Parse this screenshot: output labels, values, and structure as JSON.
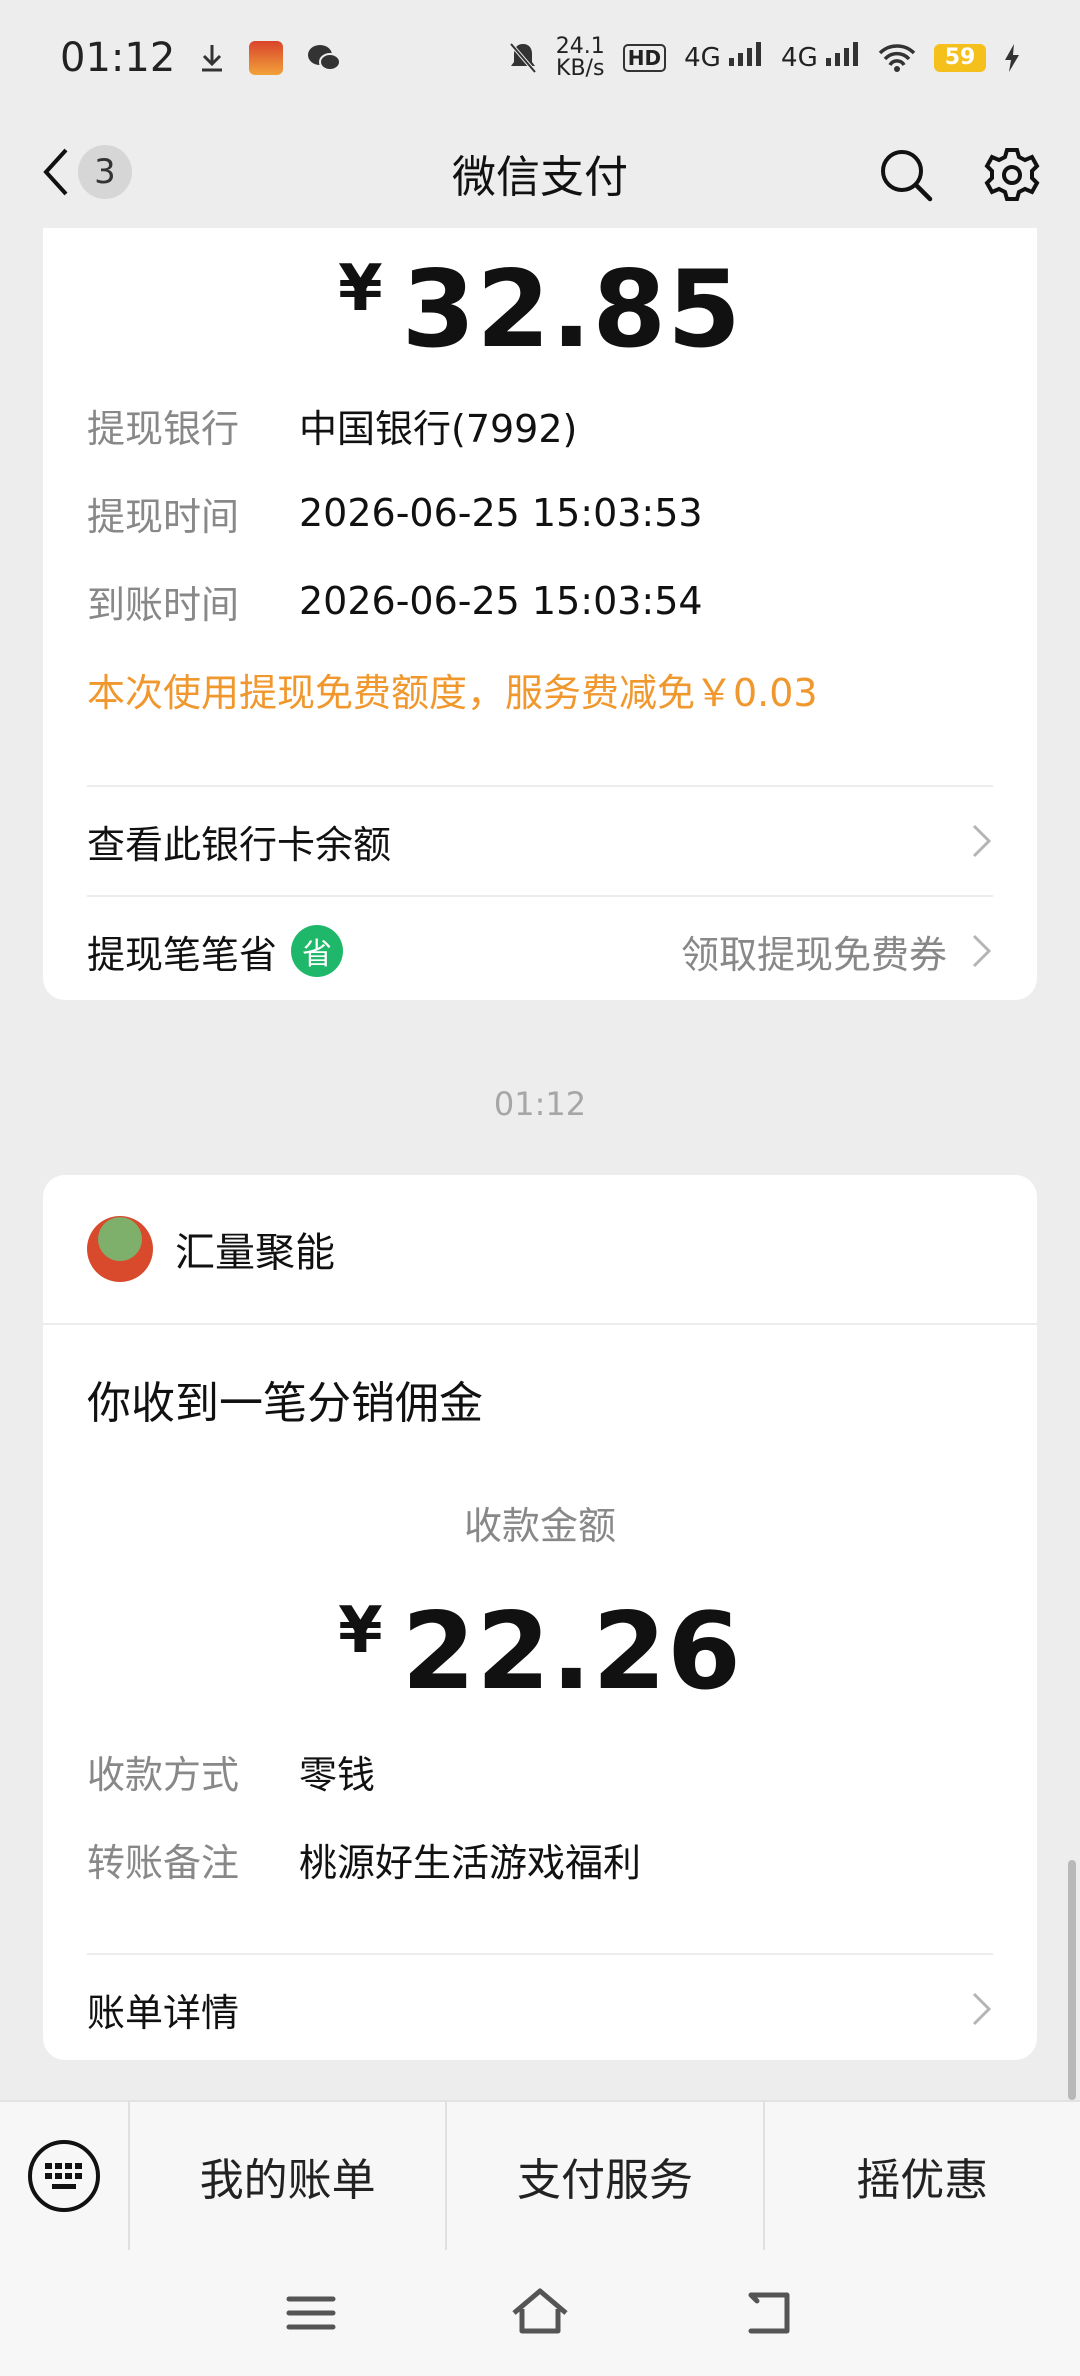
{
  "status_bar": {
    "time": "01:12",
    "net_speed_value": "24.1",
    "net_speed_unit": "KB/s",
    "hd_label": "HD",
    "sim_labels": [
      "4G",
      "4G"
    ],
    "battery": "59"
  },
  "header": {
    "back_count": "3",
    "title": "微信支付"
  },
  "withdrawal_card": {
    "currency_symbol": "¥",
    "amount": "32.85",
    "rows": [
      {
        "label": "提现银行",
        "value": "中国银行(7992)"
      },
      {
        "label": "提现时间",
        "value": "2026-06-25 15:03:53"
      },
      {
        "label": "到账时间",
        "value": "2026-06-25 15:03:54"
      }
    ],
    "promo_text": "本次使用提现免费额度，服务费减免￥0.03",
    "view_balance_label": "查看此银行卡余额",
    "save_label": "提现笔笔省",
    "save_badge": "省",
    "save_action": "领取提现免费券"
  },
  "timestamp": "01:12",
  "receipt_card": {
    "merchant_name": "汇量聚能",
    "message_title": "你收到一笔分销佣金",
    "amount_label": "收款金额",
    "currency_symbol": "¥",
    "amount": "22.26",
    "rows": [
      {
        "label": "收款方式",
        "value": "零钱"
      },
      {
        "label": "转账备注",
        "value": "桃源好生活游戏福利"
      }
    ],
    "detail_label": "账单详情"
  },
  "bottom_menu": [
    "我的账单",
    "支付服务",
    "摇优惠"
  ],
  "colors": {
    "promo": "#f0982d",
    "save_badge": "#1fb86a",
    "background": "#ededed"
  }
}
